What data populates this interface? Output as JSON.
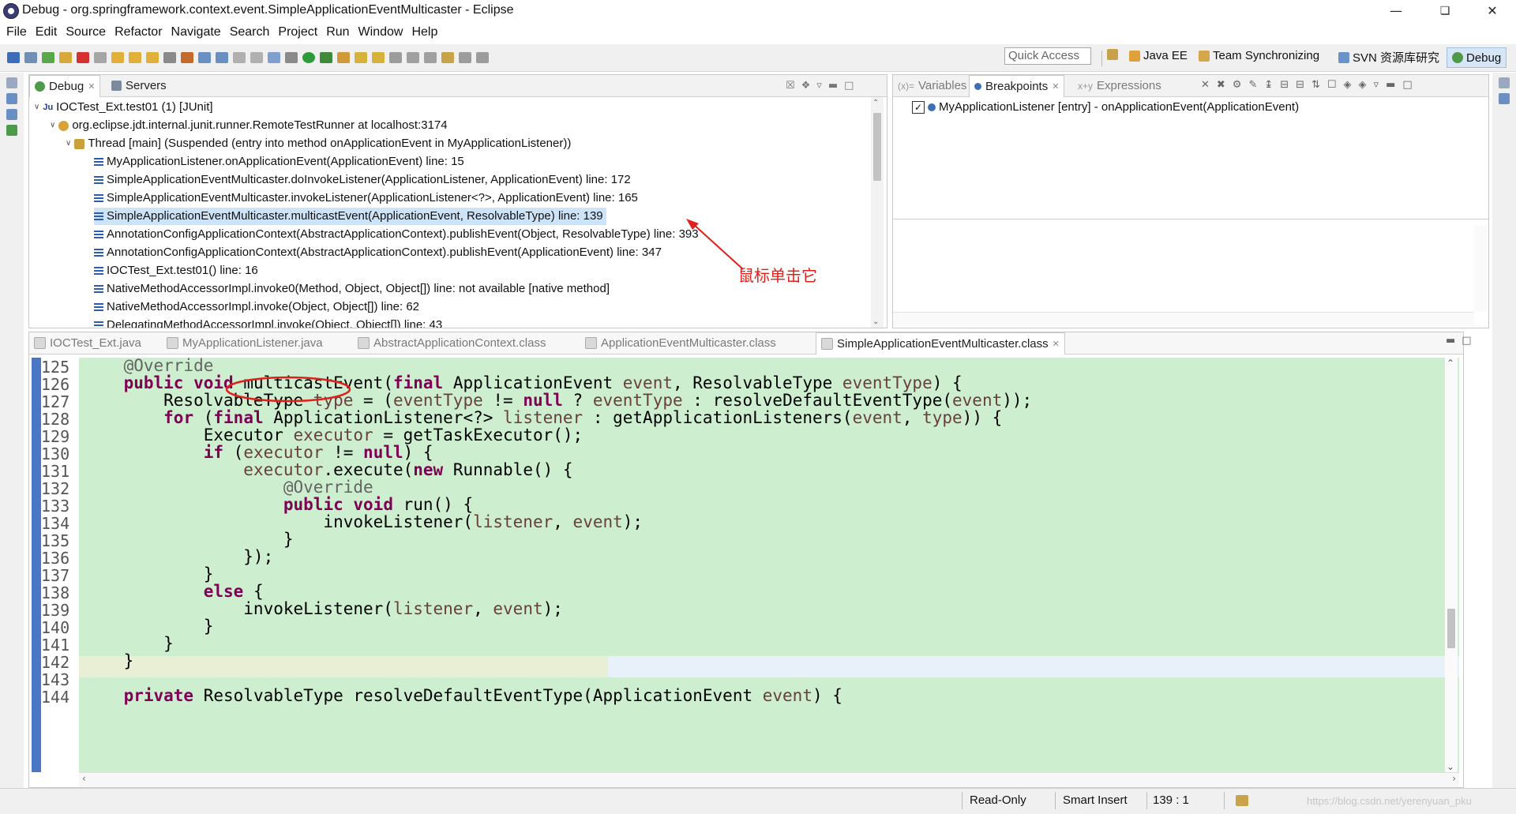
{
  "window": {
    "title": "Debug - org.springframework.context.event.SimpleApplicationEventMulticaster - Eclipse"
  },
  "menu": [
    "File",
    "Edit",
    "Source",
    "Refactor",
    "Navigate",
    "Search",
    "Project",
    "Run",
    "Window",
    "Help"
  ],
  "toolbar": {
    "quick_access_placeholder": "Quick Access"
  },
  "perspectives": [
    {
      "label": "Java EE",
      "icon": "java-ee-icon"
    },
    {
      "label": "Team Synchronizing",
      "icon": "team-sync-icon"
    },
    {
      "label": "SVN 资源库研究",
      "icon": "svn-icon"
    },
    {
      "label": "Debug",
      "icon": "debug-bug-icon",
      "active": true
    }
  ],
  "debug_view": {
    "tabs": [
      {
        "label": "Debug",
        "active": true
      },
      {
        "label": "Servers",
        "active": false
      }
    ],
    "tree": [
      {
        "text": "IOCTest_Ext.test01 (1) [JUnit]",
        "icon": "junit-launch-icon",
        "level": 0
      },
      {
        "text": "org.eclipse.jdt.internal.junit.runner.RemoteTestRunner at localhost:3174",
        "icon": "debug-target-icon",
        "level": 1
      },
      {
        "text": "Thread [main] (Suspended (entry into method onApplicationEvent in MyApplicationListener))",
        "icon": "thread-suspended-icon",
        "level": 2
      },
      {
        "text": "MyApplicationListener.onApplicationEvent(ApplicationEvent) line: 15",
        "icon": "stack-frame-icon",
        "level": 3
      },
      {
        "text": "SimpleApplicationEventMulticaster.doInvokeListener(ApplicationListener, ApplicationEvent) line: 172",
        "icon": "stack-frame-icon",
        "level": 3
      },
      {
        "text": "SimpleApplicationEventMulticaster.invokeListener(ApplicationListener<?>, ApplicationEvent) line: 165",
        "icon": "stack-frame-icon",
        "level": 3
      },
      {
        "text": "SimpleApplicationEventMulticaster.multicastEvent(ApplicationEvent, ResolvableType) line: 139",
        "icon": "stack-frame-icon",
        "level": 3,
        "selected": true
      },
      {
        "text": "AnnotationConfigApplicationContext(AbstractApplicationContext).publishEvent(Object, ResolvableType) line: 393",
        "icon": "stack-frame-icon",
        "level": 3
      },
      {
        "text": "AnnotationConfigApplicationContext(AbstractApplicationContext).publishEvent(ApplicationEvent) line: 347",
        "icon": "stack-frame-icon",
        "level": 3
      },
      {
        "text": "IOCTest_Ext.test01() line: 16",
        "icon": "stack-frame-icon",
        "level": 3
      },
      {
        "text": "NativeMethodAccessorImpl.invoke0(Method, Object, Object[]) line: not available [native method]",
        "icon": "stack-frame-icon",
        "level": 3
      },
      {
        "text": "NativeMethodAccessorImpl.invoke(Object, Object[]) line: 62",
        "icon": "stack-frame-icon",
        "level": 3
      },
      {
        "text": "DelegatingMethodAccessorImpl.invoke(Object, Object[]) line: 43",
        "icon": "stack-frame-icon",
        "level": 3
      }
    ],
    "annotation": "鼠标单击它"
  },
  "breakpoints_view": {
    "tabs": [
      {
        "label": "Variables",
        "active": false
      },
      {
        "label": "Breakpoints",
        "active": true
      },
      {
        "label": "Expressions",
        "active": false
      }
    ],
    "items": [
      {
        "text": "MyApplicationListener [entry] - onApplicationEvent(ApplicationEvent)",
        "checked": true
      }
    ]
  },
  "editor": {
    "tabs": [
      {
        "label": "IOCTest_Ext.java",
        "active": false
      },
      {
        "label": "MyApplicationListener.java",
        "active": false
      },
      {
        "label": "AbstractApplicationContext.class",
        "active": false
      },
      {
        "label": "ApplicationEventMulticaster.class",
        "active": false
      },
      {
        "label": "SimpleApplicationEventMulticaster.class",
        "active": true
      }
    ],
    "lines": [
      {
        "num": "125",
        "code": "    @Override"
      },
      {
        "num": "126",
        "code": "    public void multicastEvent(final ApplicationEvent event, ResolvableType eventType) {"
      },
      {
        "num": "127",
        "code": "        ResolvableType type = (eventType != null ? eventType : resolveDefaultEventType(event));"
      },
      {
        "num": "128",
        "code": "        for (final ApplicationListener<?> listener : getApplicationListeners(event, type)) {"
      },
      {
        "num": "129",
        "code": "            Executor executor = getTaskExecutor();"
      },
      {
        "num": "130",
        "code": "            if (executor != null) {"
      },
      {
        "num": "131",
        "code": "                executor.execute(new Runnable() {"
      },
      {
        "num": "132",
        "code": "                    @Override"
      },
      {
        "num": "133",
        "code": "                    public void run() {"
      },
      {
        "num": "134",
        "code": "                        invokeListener(listener, event);"
      },
      {
        "num": "135",
        "code": "                    }"
      },
      {
        "num": "136",
        "code": "                });"
      },
      {
        "num": "137",
        "code": "            }"
      },
      {
        "num": "138",
        "code": "            else {"
      },
      {
        "num": "139",
        "code": "                invokeListener(listener, event);"
      },
      {
        "num": "140",
        "code": "            }"
      },
      {
        "num": "141",
        "code": "        }"
      },
      {
        "num": "142",
        "code": "    }"
      },
      {
        "num": "143",
        "code": ""
      },
      {
        "num": "144",
        "code": "    private ResolvableType resolveDefaultEventType(ApplicationEvent event) {"
      }
    ],
    "current_line": "139",
    "circled_token": "multicastEvent"
  },
  "status": {
    "mode": "Read-Only",
    "insert": "Smart Insert",
    "position": "139 : 1",
    "watermark": "https://blog.csdn.net/yerenyuan_pku"
  },
  "colors": {
    "code_background": "#cdeecf",
    "keyword": "#7f0055",
    "annotation_red": "#e0201b",
    "selection": "#cde3f8"
  }
}
